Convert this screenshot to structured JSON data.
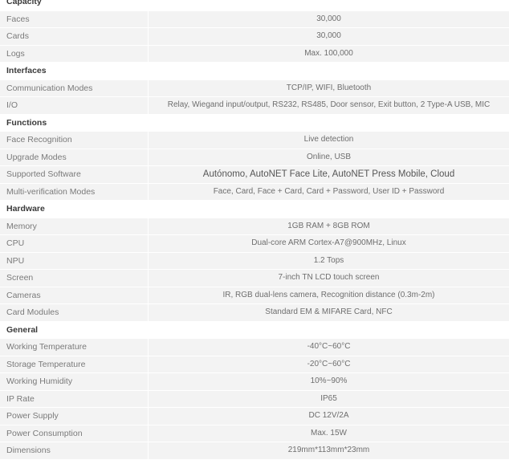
{
  "sections": [
    {
      "title": "Capacity",
      "rows": [
        {
          "label": "Faces",
          "value": "30,000"
        },
        {
          "label": "Cards",
          "value": "30,000"
        },
        {
          "label": "Logs",
          "value": "Max. 100,000"
        }
      ]
    },
    {
      "title": "Interfaces",
      "rows": [
        {
          "label": "Communication Modes",
          "value": "TCP/IP, WIFI, Bluetooth"
        },
        {
          "label": "I/O",
          "value": "Relay, Wiegand input/output, RS232, RS485, Door sensor, Exit button, 2 Type-A USB, MIC"
        }
      ]
    },
    {
      "title": "Functions",
      "rows": [
        {
          "label": "Face Recognition",
          "value": "Live detection"
        },
        {
          "label": "Upgrade Modes",
          "value": "Online, USB"
        },
        {
          "label": "Supported Software",
          "value": "Autónomo, AutoNET Face Lite, AutoNET Press Mobile, Cloud"
        },
        {
          "label": "Multi-verification Modes",
          "value": "Face, Card, Face + Card, Card + Password, User ID + Password"
        }
      ]
    },
    {
      "title": "Hardware",
      "rows": [
        {
          "label": "Memory",
          "value": "1GB RAM + 8GB ROM"
        },
        {
          "label": "CPU",
          "value": "Dual-core ARM Cortex-A7@900MHz, Linux"
        },
        {
          "label": "NPU",
          "value": "1.2 Tops"
        },
        {
          "label": "Screen",
          "value": "7-inch TN LCD touch screen"
        },
        {
          "label": "Cameras",
          "value": "IR, RGB dual-lens camera, Recognition distance (0.3m-2m)"
        },
        {
          "label": "Card Modules",
          "value": "Standard EM & MIFARE Card, NFC"
        }
      ]
    },
    {
      "title": "General",
      "rows": [
        {
          "label": "Working Temperature",
          "value": "-40°C~60°C"
        },
        {
          "label": "Storage Temperature",
          "value": "-20°C~60°C"
        },
        {
          "label": "Working Humidity",
          "value": "10%~90%"
        },
        {
          "label": "IP Rate",
          "value": "IP65"
        },
        {
          "label": "Power Supply",
          "value": "DC 12V/2A"
        },
        {
          "label": "Power Consumption",
          "value": "Max. 15W"
        },
        {
          "label": "Dimensions",
          "value": "219mm*113mm*23mm"
        }
      ]
    }
  ]
}
